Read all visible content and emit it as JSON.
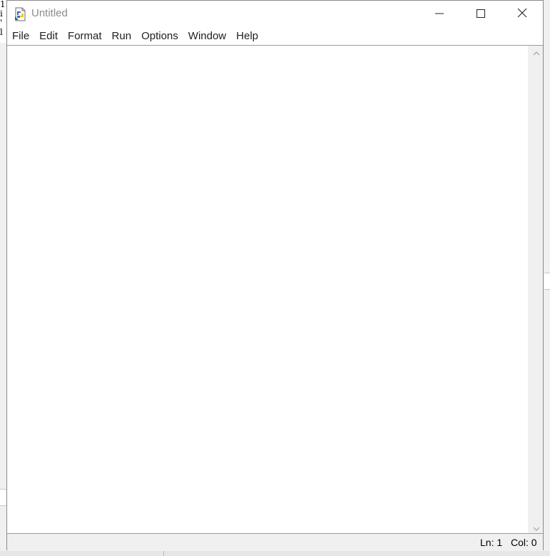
{
  "window": {
    "title": "Untitled",
    "controls": [
      "minimize",
      "maximize",
      "close"
    ]
  },
  "menubar": {
    "items": [
      {
        "label": "File"
      },
      {
        "label": "Edit"
      },
      {
        "label": "Format"
      },
      {
        "label": "Run"
      },
      {
        "label": "Options"
      },
      {
        "label": "Window"
      },
      {
        "label": "Help"
      }
    ]
  },
  "editor": {
    "content": ""
  },
  "statusbar": {
    "line": "Ln: 1",
    "column": "Col: 0"
  },
  "background": {
    "sliver_text": [
      "1",
      "i",
      "'",
      "l"
    ]
  },
  "icons": {
    "app": "python-file-icon",
    "minimize": "minimize-icon",
    "maximize": "maximize-icon",
    "close": "close-icon",
    "scroll_up": "chevron-up-icon",
    "scroll_down": "chevron-down-icon"
  },
  "colors": {
    "title_text": "#8c8c8c",
    "menu_text": "#1e1e1e",
    "chrome": "#f0f0f0",
    "editor_bg": "#ffffff"
  }
}
